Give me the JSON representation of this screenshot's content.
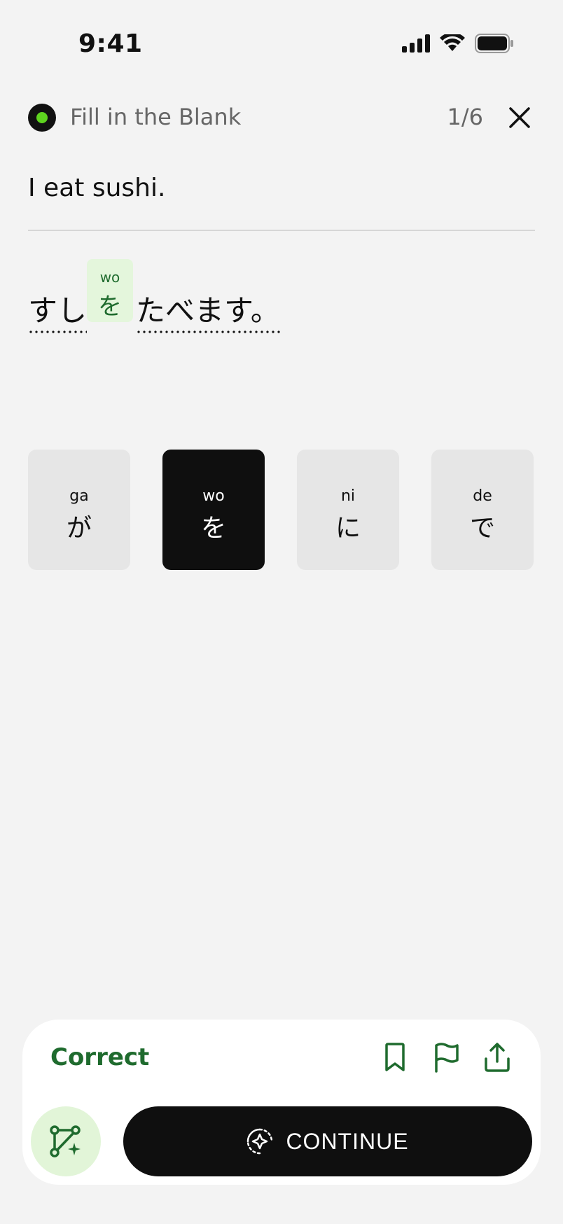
{
  "status_bar": {
    "time": "9:41"
  },
  "header": {
    "title": "Fill in the Blank",
    "progress": "1/6"
  },
  "prompt": {
    "english": "I eat sushi."
  },
  "sentence": {
    "word_before": "すし",
    "filled_blank": {
      "romaji": "wo",
      "kana": "を"
    },
    "word_after": "たべます。"
  },
  "options": [
    {
      "romaji": "ga",
      "kana": "が",
      "selected": false
    },
    {
      "romaji": "wo",
      "kana": "を",
      "selected": true
    },
    {
      "romaji": "ni",
      "kana": "に",
      "selected": false
    },
    {
      "romaji": "de",
      "kana": "で",
      "selected": false
    }
  ],
  "feedback": {
    "status": "Correct",
    "continue_label": "CONTINUE"
  },
  "colors": {
    "accent_green": "#1f6b2e",
    "indicator_green": "#5ed31f",
    "blank_bg": "#e4f6dc",
    "selected_option": "#0f0f0f"
  },
  "icons": [
    "signal-icon",
    "wifi-icon",
    "battery-icon",
    "close-icon",
    "bookmark-icon",
    "flag-icon",
    "share-icon",
    "vector-edit-icon",
    "sparkle-icon"
  ]
}
